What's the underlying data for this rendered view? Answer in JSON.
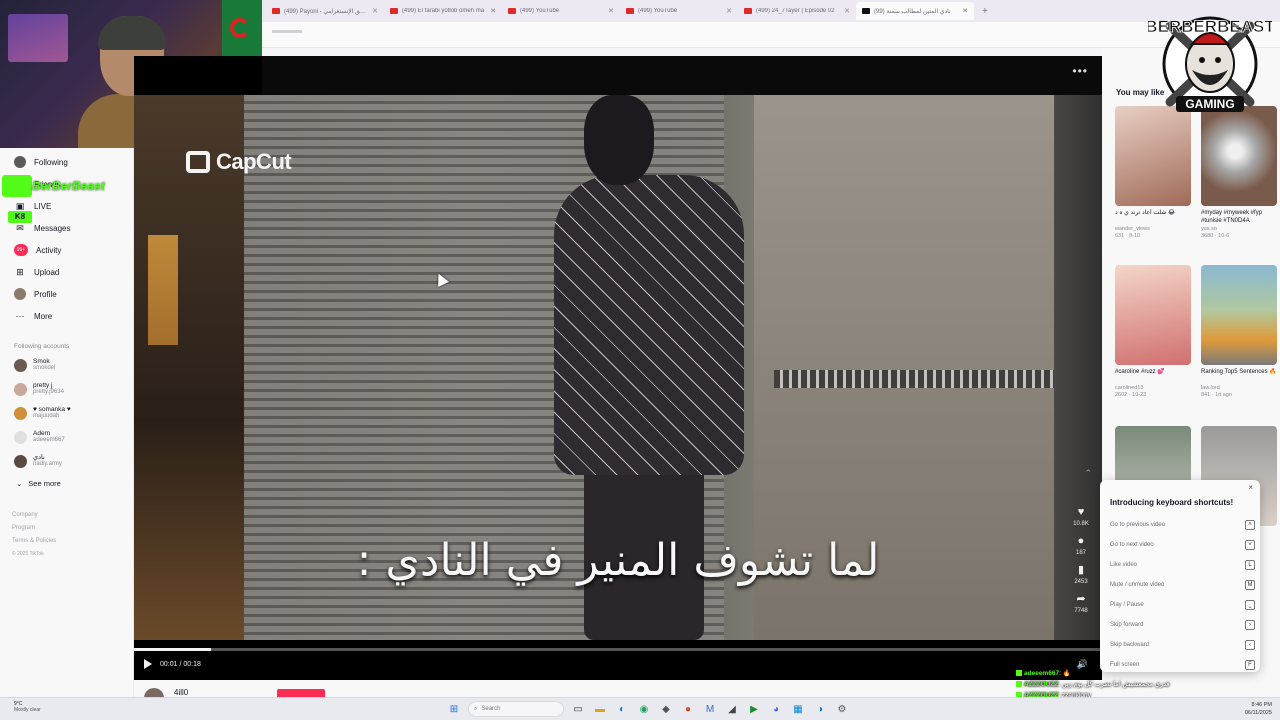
{
  "browser": {
    "tabs": [
      {
        "title": "(499) Payoni - نعشق الإنستغرامي",
        "type": "youtube"
      },
      {
        "title": "(499) El farabi yotlob omeh ma",
        "type": "youtube"
      },
      {
        "title": "(499) YouTube",
        "type": "youtube"
      },
      {
        "title": "(499) YouTube",
        "type": "youtube"
      },
      {
        "title": "(499) 24_7Tayer | Episode 02",
        "type": "youtube"
      },
      {
        "title": "(99) نادي المتين لمطالب سمنة",
        "type": "tiktok",
        "active": true
      }
    ],
    "new_tab": "+"
  },
  "stream": {
    "channel": "BerBerBeast",
    "kick_tag": "K8",
    "logo_top": "BERBERBEAST",
    "logo_bottom": "GAMING"
  },
  "sidebar": {
    "items": [
      {
        "label": "Following",
        "icon": "following-icon"
      },
      {
        "label": "Friends",
        "icon": "friends-icon"
      },
      {
        "label": "LIVE",
        "icon": "live-icon"
      },
      {
        "label": "Messages",
        "icon": "messages-icon"
      },
      {
        "label": "Activity",
        "icon": "activity-icon",
        "badge": "99+"
      },
      {
        "label": "Upload",
        "icon": "upload-icon"
      },
      {
        "label": "Profile",
        "icon": "profile-icon"
      },
      {
        "label": "More",
        "icon": "more-icon"
      }
    ],
    "following_title": "Following accounts",
    "accounts": [
      {
        "name": "Smok",
        "handle": "smokdel"
      },
      {
        "name": "pretty j",
        "handle": "pretty.j9634"
      },
      {
        "name": "♥ somanka ♥",
        "handle": "majuudah"
      },
      {
        "name": "Adem",
        "handle": "adeeem667"
      },
      {
        "name": "نادي",
        "handle": "nadiy.army"
      }
    ],
    "see_more": "See more",
    "footer": [
      "Company",
      "Program",
      "Terms & Policies",
      "© 2025 TikTok"
    ]
  },
  "video": {
    "watermark": "CapCut",
    "caption": "لما تشوف المنير في النادي :",
    "time": "00:01 / 00:18",
    "progress": 0.08,
    "actions": [
      {
        "icon": "heart-icon",
        "count": "10.8K"
      },
      {
        "icon": "comment-icon",
        "count": "187"
      },
      {
        "icon": "bookmark-icon",
        "count": "2453"
      },
      {
        "icon": "share-icon",
        "count": "7748"
      }
    ],
    "more": "•••",
    "author": "4ill0"
  },
  "recommendations": {
    "title": "You may like",
    "cards": [
      {
        "title": "شلت أعاد ترند ي ه د 😂",
        "author": "wander_views",
        "views": "631",
        "date": "8-10",
        "colors": [
          "#d9b8a8",
          "#7a4a3a"
        ]
      },
      {
        "title": "#myday #myweek #fyp #tunisie #TN0D4A",
        "author": "yas.so",
        "views": "3680",
        "date": "10-6",
        "colors": [
          "#d8d8d8",
          "#8a6a5a"
        ]
      },
      {
        "title": "#caroline #ruzz 💕",
        "author": "carolined13",
        "views": "2602",
        "date": "10-23",
        "colors": [
          "#f0c0b0",
          "#c06060"
        ]
      },
      {
        "title": "Ranking Top5 Sentences 🔥",
        "author": "law.lord",
        "views": "841",
        "date": "1d ago",
        "colors": [
          "#a0c4d0",
          "#d08a3a"
        ]
      },
      {
        "title": "",
        "author": "",
        "views": "",
        "date": "",
        "colors": [
          "#6a7a6a",
          "#c8c8c0"
        ]
      },
      {
        "title": "",
        "author": "",
        "views": "",
        "date": "",
        "colors": [
          "#8a8a8a",
          "#d0c8c0"
        ]
      }
    ]
  },
  "shortcuts": {
    "title": "Introducing keyboard shortcuts!",
    "close": "×",
    "rows": [
      {
        "label": "Go to previous video",
        "key": "˄"
      },
      {
        "label": "Go to next video",
        "key": "˅"
      },
      {
        "label": "Like video",
        "key": "L"
      },
      {
        "label": "Mute / unmute video",
        "key": "M"
      },
      {
        "label": "Play / Pause",
        "key": "⎵"
      },
      {
        "label": "Skip forward",
        "key": "›"
      },
      {
        "label": "Skip backward",
        "key": "‹"
      },
      {
        "label": "Full screen",
        "key": "F"
      }
    ]
  },
  "chat": [
    {
      "user": "adeeem667",
      "text": "🔥"
    },
    {
      "user": "AZZZOUZZ",
      "text": "فدري مجمعشيش اما نضرب كل يوم زين"
    },
    {
      "user": "AZZZOUZZ",
      "text": "zzanklony"
    }
  ],
  "taskbar": {
    "temp": "9°C",
    "weather": "Mostly clear",
    "search": "Search",
    "time": "8:46 PM",
    "date": "06/11/2025"
  }
}
